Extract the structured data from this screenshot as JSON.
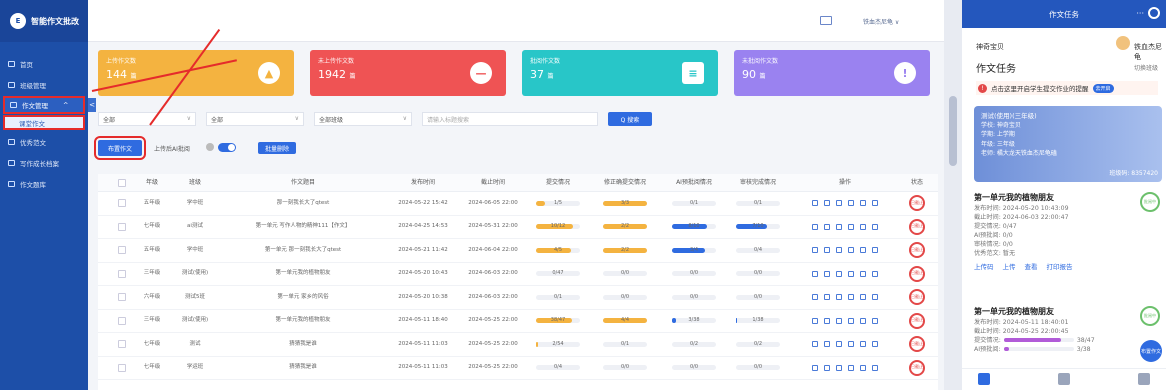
{
  "app": {
    "logo_mark": "E",
    "name": "智能作文批改"
  },
  "sidebar": {
    "items": [
      {
        "label": "首页"
      },
      {
        "label": "班级管理"
      },
      {
        "label": "作文管理"
      },
      {
        "label": "课堂作文"
      },
      {
        "label": "优秀范文"
      },
      {
        "label": "写作成长档案"
      },
      {
        "label": "作文题库"
      }
    ]
  },
  "topbar": {
    "user": "铁血杰尼龟 ∨",
    "collapse_glyph": "<"
  },
  "cards": [
    {
      "label": "上传作文数",
      "value": "144",
      "unit": "篇",
      "glyph": "▲",
      "color": "#f4b340"
    },
    {
      "label": "未上传作文数",
      "value": "1942",
      "unit": "篇",
      "glyph": "—",
      "color": "#ef5354"
    },
    {
      "label": "批阅作文数",
      "value": "37",
      "unit": "篇",
      "glyph": "≡",
      "color": "#28c6c8"
    },
    {
      "label": "未批阅作文数",
      "value": "90",
      "unit": "篇",
      "glyph": "!",
      "color": "#9a82f0"
    }
  ],
  "filters": {
    "grade": "全部",
    "type": "全部",
    "class": "全部班级",
    "search_placeholder": "请输入标题搜索",
    "search_btn": "Q 搜索",
    "chevron": "∨"
  },
  "toolbar": {
    "assign": "布置作文",
    "ai_label": "上传后AI批阅",
    "batch_delete": "批量删除"
  },
  "table": {
    "headers": [
      "年级",
      "班级",
      "作文题目",
      "发布时间",
      "截止时间",
      "提交情况",
      "修正确提交情况",
      "AI预批阅情况",
      "审核完成情况",
      "操作",
      "状态"
    ],
    "status_text": "已截止",
    "rows": [
      {
        "grade": "五年级",
        "cls": "学中班",
        "title": "那一刻我长大了qtest",
        "pub": "2024-05-22 15:42",
        "due": "2024-06-05 22:00",
        "submit": "1/5",
        "fix": "3/3",
        "ai": "0/1",
        "audit": "0/1",
        "submit_frac": 0.2,
        "fix_frac": 1,
        "ai_frac": 0,
        "audit_frac": 0
      },
      {
        "grade": "七年级",
        "cls": "ai测试",
        "title": "第一单元 写作人物的精神111【作文】",
        "pub": "2024-04-25 14:53",
        "due": "2024-05-31 22:00",
        "submit": "10/12",
        "fix": "2/2",
        "ai": "8/10",
        "audit": "7/10",
        "submit_frac": 0.83,
        "fix_frac": 1,
        "ai_frac": 0.8,
        "audit_frac": 0.7
      },
      {
        "grade": "五年级",
        "cls": "学中班",
        "title": "第一单元 那一刻我长大了qtest",
        "pub": "2024-05-21 11:42",
        "due": "2024-06-04 22:00",
        "submit": "4/5",
        "fix": "2/2",
        "ai": "3/4",
        "audit": "0/4",
        "submit_frac": 0.8,
        "fix_frac": 1,
        "ai_frac": 0.75,
        "audit_frac": 0
      },
      {
        "grade": "三年级",
        "cls": "测试(使用)",
        "title": "第一单元我的植物朋友",
        "pub": "2024-05-20 10:43",
        "due": "2024-06-03 22:00",
        "submit": "0/47",
        "fix": "0/0",
        "ai": "0/0",
        "audit": "0/0",
        "submit_frac": 0,
        "fix_frac": 0,
        "ai_frac": 0,
        "audit_frac": 0
      },
      {
        "grade": "六年级",
        "cls": "测试5班",
        "title": "第一单元 家乡的风俗",
        "pub": "2024-05-20 10:38",
        "due": "2024-06-03 22:00",
        "submit": "0/1",
        "fix": "0/0",
        "ai": "0/0",
        "audit": "0/0",
        "submit_frac": 0,
        "fix_frac": 0,
        "ai_frac": 0,
        "audit_frac": 0
      },
      {
        "grade": "三年级",
        "cls": "测试(使用)",
        "title": "第一单元我的植物朋友",
        "pub": "2024-05-11 18:40",
        "due": "2024-05-25 22:00",
        "submit": "38/47",
        "fix": "4/4",
        "ai": "3/38",
        "audit": "1/38",
        "submit_frac": 0.81,
        "fix_frac": 1,
        "ai_frac": 0.08,
        "audit_frac": 0.03
      },
      {
        "grade": "七年级",
        "cls": "测试",
        "title": "猜猜我是谁",
        "pub": "2024-05-11 11:03",
        "due": "2024-05-25 22:00",
        "submit": "2/54",
        "fix": "0/1",
        "ai": "0/2",
        "audit": "0/2",
        "submit_frac": 0.04,
        "fix_frac": 0,
        "ai_frac": 0,
        "audit_frac": 0
      },
      {
        "grade": "七年级",
        "cls": "学运班",
        "title": "猜猜我是谁",
        "pub": "2024-05-11 11:03",
        "due": "2024-05-25 22:00",
        "submit": "0/4",
        "fix": "0/0",
        "ai": "0/0",
        "audit": "0/0",
        "submit_frac": 0,
        "fix_frac": 0,
        "ai_frac": 0,
        "audit_frac": 0
      }
    ]
  },
  "right_panel": {
    "header": "作文任务",
    "more": "···",
    "school": "神奇宝贝",
    "user": "铁血杰尼龟",
    "title": "作文任务",
    "switch": "切换班级",
    "notice": "点击这里开启学生提交作业的提醒",
    "notice_btn": "去开启",
    "notice_icon": "!",
    "banner": {
      "title": "测试(使用)(三年级)",
      "lines": [
        "学校: 神奇宝贝",
        "学期: 上学期",
        "年级: 三年级",
        "老师: 橘大龙天铁血杰尼龟磕"
      ],
      "code": "班级码: 8357420"
    },
    "tasks": [
      {
        "title": "第一单元我的植物朋友",
        "stamp": "批阅中",
        "lines": [
          "发布时间: 2024-05-20 10:43:09",
          "截止时间: 2024-06-03 22:00:47",
          "提交情况:  0/47",
          "AI预批阅:  0/0",
          "审核情况:  0/0",
          "优秀范文: 暂无"
        ],
        "actions": [
          "上传码",
          "上传",
          "查看",
          "打印报告"
        ]
      },
      {
        "title": "第一单元我的植物朋友",
        "stamp": "批阅中",
        "lines": [
          "发布时间: 2024-05-11 18:40:01",
          "截止时间: 2024-05-25 22:00:45"
        ],
        "bars": [
          {
            "label": "提交情况:",
            "value": "38/47",
            "frac": 0.81
          },
          {
            "label": "AI预批阅:",
            "value": "3/38",
            "frac": 0.08
          }
        ]
      }
    ],
    "float_btn": "布置作文"
  }
}
